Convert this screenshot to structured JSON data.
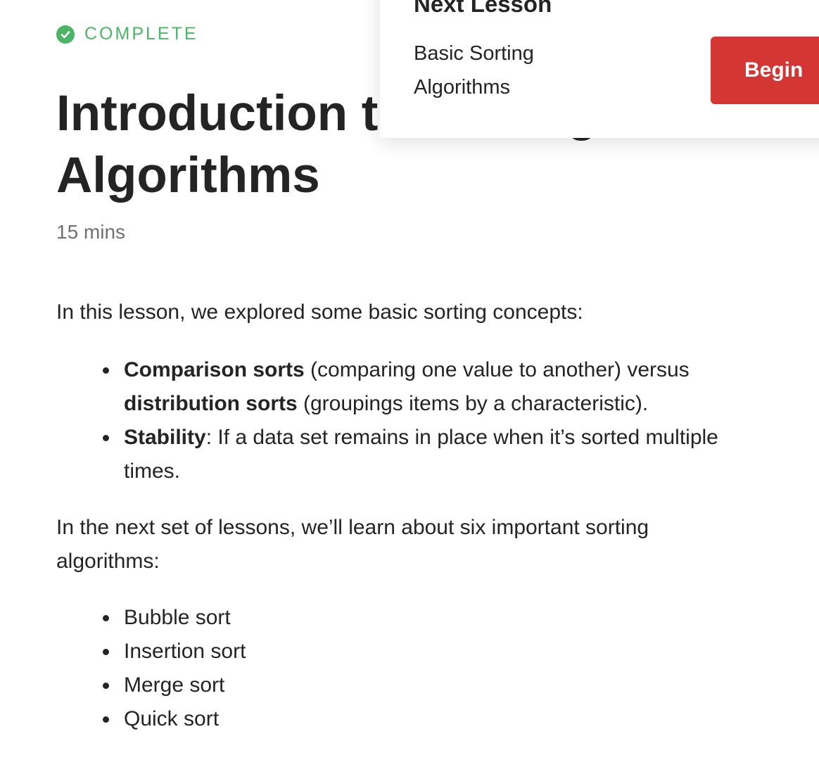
{
  "status": {
    "icon": "check-circle-icon",
    "label": "COMPLETE",
    "color": "#4cb464"
  },
  "lesson": {
    "title": "Introduction to Sorting Algorithms",
    "duration": "15 mins"
  },
  "content": {
    "intro": "In this lesson, we explored some basic sorting concepts:",
    "concepts": [
      {
        "term1": "Comparison sorts",
        "text1": " (comparing one value to another) versus ",
        "term2": "distribution sorts",
        "text2": " (groupings items by a characteristic)."
      },
      {
        "term1": "Stability",
        "text1": ": If a data set remains in place when it’s sorted multiple times."
      }
    ],
    "next_intro": "In the next set of lessons, we’ll learn about six important sorting algorithms:",
    "algorithms": [
      "Bubble sort",
      "Insertion sort",
      "Merge sort",
      "Quick sort"
    ]
  },
  "next_lesson": {
    "heading": "Next Lesson",
    "name": "Basic Sorting Algorithms",
    "button_label": "Begin",
    "button_color": "#d43633"
  }
}
